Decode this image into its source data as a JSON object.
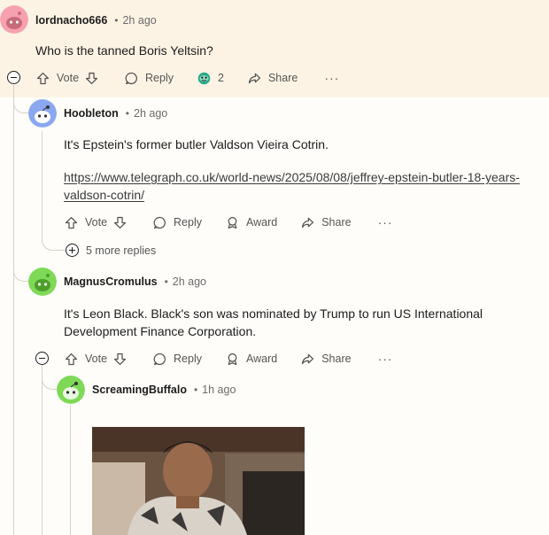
{
  "comments": [
    {
      "username": "lordnacho666",
      "time": "2h ago",
      "body": "Who is the tanned Boris Yeltsin?",
      "actions": {
        "vote": "Vote",
        "reply": "Reply",
        "award_count": "2",
        "share": "Share",
        "more": "···"
      }
    },
    {
      "username": "Hoobleton",
      "time": "2h ago",
      "body": "It's Epstein's former butler Valdson Vieira Cotrin.",
      "link_line1": "https://www.telegraph.co.uk/world-news/2025/08/08/jeffrey-epstein-butler-18-years-",
      "link_line2": "valdson-cotrin/",
      "actions": {
        "vote": "Vote",
        "reply": "Reply",
        "award": "Award",
        "share": "Share",
        "more": "···"
      },
      "more_replies": "5 more replies"
    },
    {
      "username": "MagnusCromulus",
      "time": "2h ago",
      "body_line1": "It's Leon Black. Black's son was nominated by Trump to run US International",
      "body_line2": "Development Finance Corporation.",
      "actions": {
        "vote": "Vote",
        "reply": "Reply",
        "award": "Award",
        "share": "Share",
        "more": "···"
      }
    },
    {
      "username": "ScreamingBuffalo",
      "time": "1h ago"
    }
  ],
  "separator": "•",
  "colors": {
    "highlight_bg": "#fdf3e4",
    "avatar_pink": "#f7a1b0",
    "avatar_blue": "#8aa7f0",
    "avatar_green": "#7ed957"
  }
}
